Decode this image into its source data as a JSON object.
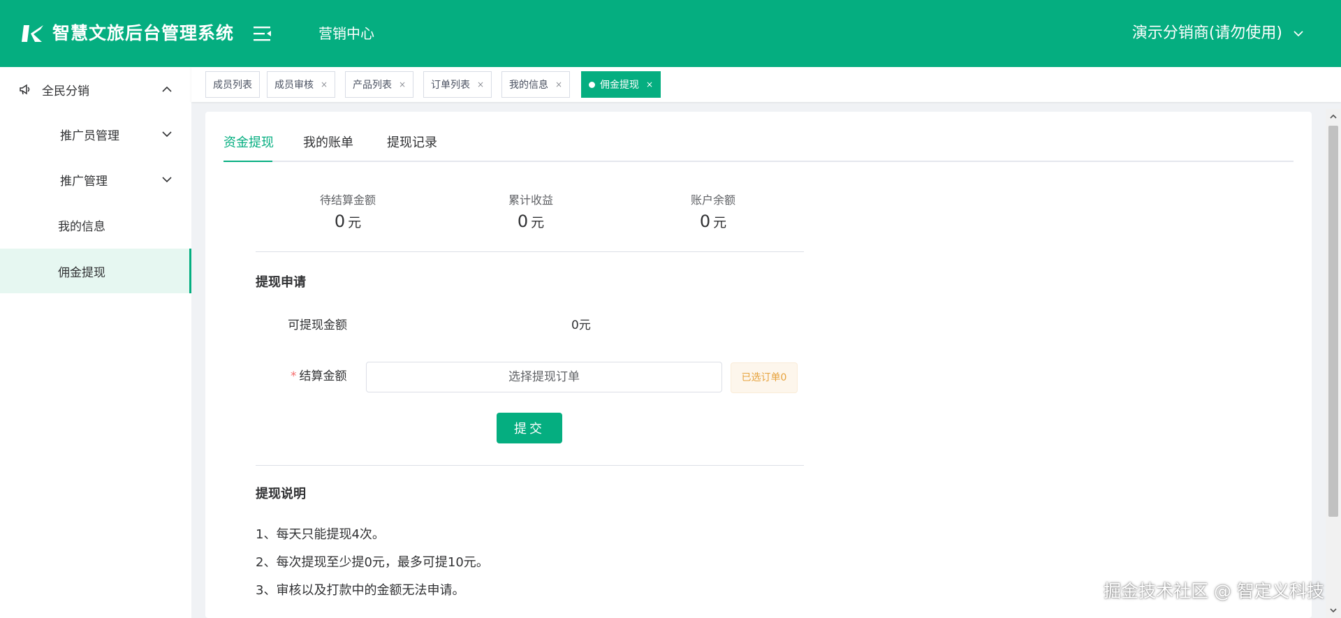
{
  "header": {
    "app_title": "智慧文旅后台管理系统",
    "nav_link": "营销中心",
    "user_name": "演示分销商(请勿使用)",
    "bg_color": "#05ae80"
  },
  "sidebar": {
    "group_label": "全民分销",
    "items": [
      {
        "label": "推广员管理"
      },
      {
        "label": "推广管理"
      },
      {
        "label": "我的信息"
      },
      {
        "label": "佣金提现"
      }
    ]
  },
  "tagbar": {
    "tags": [
      {
        "label": "成员列表",
        "close": ""
      },
      {
        "label": "成员审核",
        "close": "×"
      },
      {
        "label": "产品列表",
        "close": "×"
      },
      {
        "label": "订单列表",
        "close": "×"
      },
      {
        "label": "我的信息",
        "close": "×"
      },
      {
        "label": "佣金提现",
        "close": "×"
      }
    ]
  },
  "tabs": [
    {
      "label": "资金提现"
    },
    {
      "label": "我的账单"
    },
    {
      "label": "提现记录"
    }
  ],
  "stats": [
    {
      "label": "待结算金额",
      "value": "0",
      "unit": "元"
    },
    {
      "label": "累计收益",
      "value": "0",
      "unit": "元"
    },
    {
      "label": "账户余额",
      "value": "0",
      "unit": "元"
    }
  ],
  "apply": {
    "title": "提现申请",
    "available_label": "可提现金额",
    "available_value": "0元",
    "required_mark": "*",
    "settle_label": "结算金额",
    "settle_placeholder": "选择提现订单",
    "selected_badge": "已选订单0",
    "submit_label": "提交"
  },
  "notes": {
    "title": "提现说明",
    "lines": [
      "1、每天只能提现4次。",
      "2、每次提现至少提0元，最多可提10元。",
      "3、审核以及打款中的金额无法申请。"
    ]
  },
  "watermark": "掘金技术社区 @ 智定义科技"
}
